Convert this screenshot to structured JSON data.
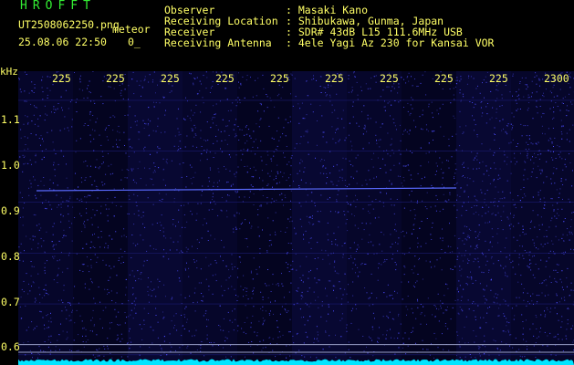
{
  "header": {
    "app_title": "HROFFT",
    "filename": "UT2508062250.png",
    "mode": "meteor",
    "datetime": "25.08.06 22:50",
    "level": "0_"
  },
  "station_info": [
    {
      "label": "Observer",
      "value": ": Masaki Kano"
    },
    {
      "label": "Receiving Location",
      "value": ": Shibukawa, Gunma, Japan"
    },
    {
      "label": "Receiver",
      "value": ": SDR# 43dB L15 111.6MHz USB"
    },
    {
      "label": "Receiving Antenna",
      "value": ": 4ele Yagi Az 230 for Kansai VOR"
    }
  ],
  "axes": {
    "y_unit": "kHz",
    "x_ticks": [
      "225",
      "225",
      "225",
      "225",
      "225",
      "225",
      "225",
      "225",
      "225",
      "2300"
    ],
    "y_ticks": [
      "1.1",
      "1.0",
      "0.9",
      "0.8",
      "0.7",
      "0.6"
    ]
  },
  "chart_data": {
    "type": "heatmap",
    "title": "",
    "xlabel": "",
    "ylabel": "kHz",
    "x_tick_labels": [
      "225",
      "225",
      "225",
      "225",
      "225",
      "225",
      "225",
      "225",
      "225",
      "2300"
    ],
    "y_tick_values": [
      1.1,
      1.0,
      0.9,
      0.8,
      0.7,
      0.6
    ],
    "ylim": [
      0.58,
      1.15
    ],
    "carrier_line_khz": 0.925,
    "reference_lines_khz": [
      0.62,
      0.605
    ],
    "grid": true
  },
  "colors": {
    "background": "#000000",
    "waterfall_bg": "#06062a",
    "noise": "#3a3aff",
    "text": "#ffff66",
    "title": "#33ee33",
    "grid": "#1a1a70",
    "baseline": "#00e5ff",
    "ref_line": "#9aa0c8"
  }
}
